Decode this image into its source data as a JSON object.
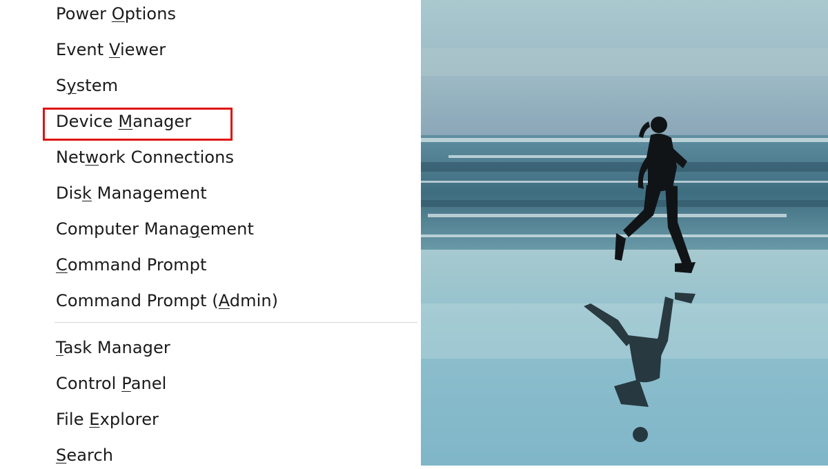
{
  "menu": {
    "items": [
      {
        "pre": "Power ",
        "acc": "O",
        "post": "ptions"
      },
      {
        "pre": "Event ",
        "acc": "V",
        "post": "iewer"
      },
      {
        "pre": "S",
        "acc": "y",
        "post": "stem"
      },
      {
        "pre": "Device ",
        "acc": "M",
        "post": "anager"
      },
      {
        "pre": "Net",
        "acc": "w",
        "post": "ork Connections"
      },
      {
        "pre": "Dis",
        "acc": "k",
        "post": " Management"
      },
      {
        "pre": "Computer Mana",
        "acc": "g",
        "post": "ement"
      },
      {
        "pre": "",
        "acc": "C",
        "post": "ommand Prompt"
      },
      {
        "pre": "Command Prompt (",
        "acc": "A",
        "post": "dmin)"
      },
      {
        "pre": "",
        "acc": "T",
        "post": "ask Manager"
      },
      {
        "pre": "Control ",
        "acc": "P",
        "post": "anel"
      },
      {
        "pre": "File ",
        "acc": "E",
        "post": "xplorer"
      },
      {
        "pre": "",
        "acc": "S",
        "post": "earch"
      }
    ],
    "highlighted_item": "Device Manager",
    "highlight_color": "#e01010"
  },
  "wallpaper": {
    "subject": "runner-on-beach-image",
    "sky_color": "#8fb6c4",
    "sea_color": "#4a7a8e",
    "sand_color": "#9cc8d4"
  }
}
